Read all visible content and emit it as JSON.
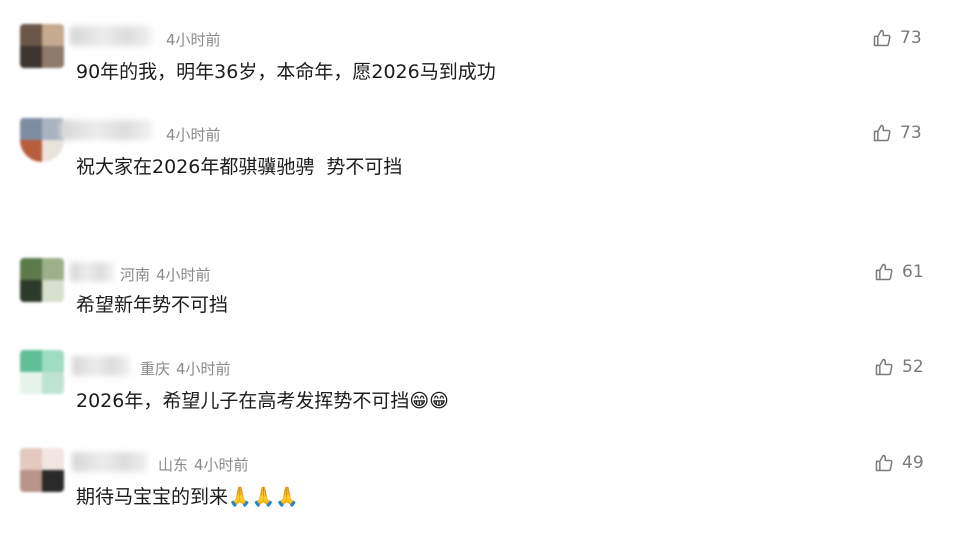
{
  "comments": [
    {
      "location": "",
      "time": "4小时前",
      "text": "90年的我，明年36岁，本命年，愿2026马到成功",
      "likes": "73",
      "avatar_colors": [
        "#6b5546",
        "#c7a98f",
        "#3d3630",
        "#8e7a6b"
      ]
    },
    {
      "location": "",
      "time": "4小时前",
      "text": "祝大家在2026年都骐骥驰骋  势不可挡",
      "likes": "73",
      "avatar_colors": [
        "#7f8da3",
        "#a9b3c0",
        "#b85d3b",
        "#e9e3dc"
      ]
    },
    {
      "location": "河南",
      "time": "4小时前",
      "text": "希望新年势不可挡",
      "likes": "61",
      "avatar_colors": [
        "#5c7a4a",
        "#2e3a2b",
        "#9cb089",
        "#d7dfcd"
      ]
    },
    {
      "location": "重庆",
      "time": "4小时前",
      "text": "2026年，希望儿子在高考发挥势不可挡",
      "likes": "52",
      "emoji": "😁😁",
      "avatar_colors": [
        "#5fbf98",
        "#9fdcc2",
        "#e6f3ec",
        "#bfe3d2"
      ]
    },
    {
      "location": "山东",
      "time": "4小时前",
      "text": "期待马宝宝的到来",
      "likes": "49",
      "emoji": "🙏🙏🙏",
      "avatar_colors": [
        "#e3c9c0",
        "#2a2a2a",
        "#f1e6e2",
        "#b8948a"
      ]
    }
  ],
  "colors": {
    "meta": "#8a8a8a",
    "text": "#1c1c1c",
    "like": "#7a7a7a"
  },
  "icons": {
    "like": "thumbs-up-icon"
  }
}
